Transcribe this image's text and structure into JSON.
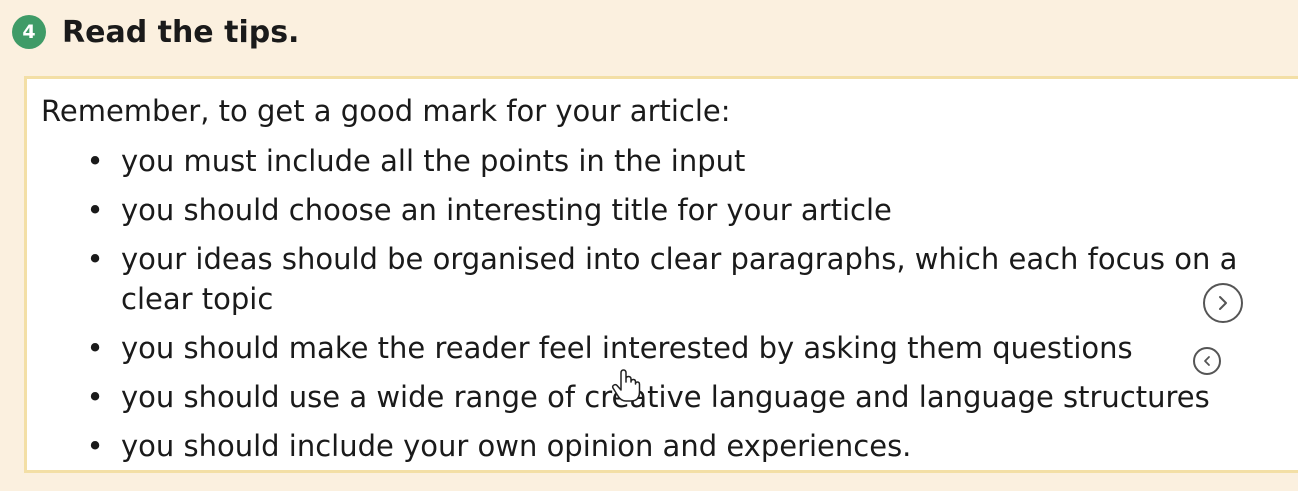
{
  "header": {
    "step_number": "4",
    "title": "Read the tips."
  },
  "tips_box": {
    "intro": "Remember, to get a good mark for your article:",
    "items": [
      "you must include all the points in the input",
      "you should choose an interesting title for your article",
      "your ideas should be organised into clear paragraphs, which each focus on a clear topic",
      "you should make the reader feel interested by asking them questions",
      "you should use a wide range of creative language and language structures",
      "you should include your own opinion and experiences."
    ]
  },
  "controls": {
    "next_icon": "chevron-right-icon",
    "prev_icon": "chevron-left-icon",
    "cursor_icon": "hand-pointer-icon"
  },
  "colors": {
    "background": "#fbf0df",
    "badge": "#3f9b67",
    "box_border": "#f3dfa6",
    "box_fill": "#ffffff"
  }
}
